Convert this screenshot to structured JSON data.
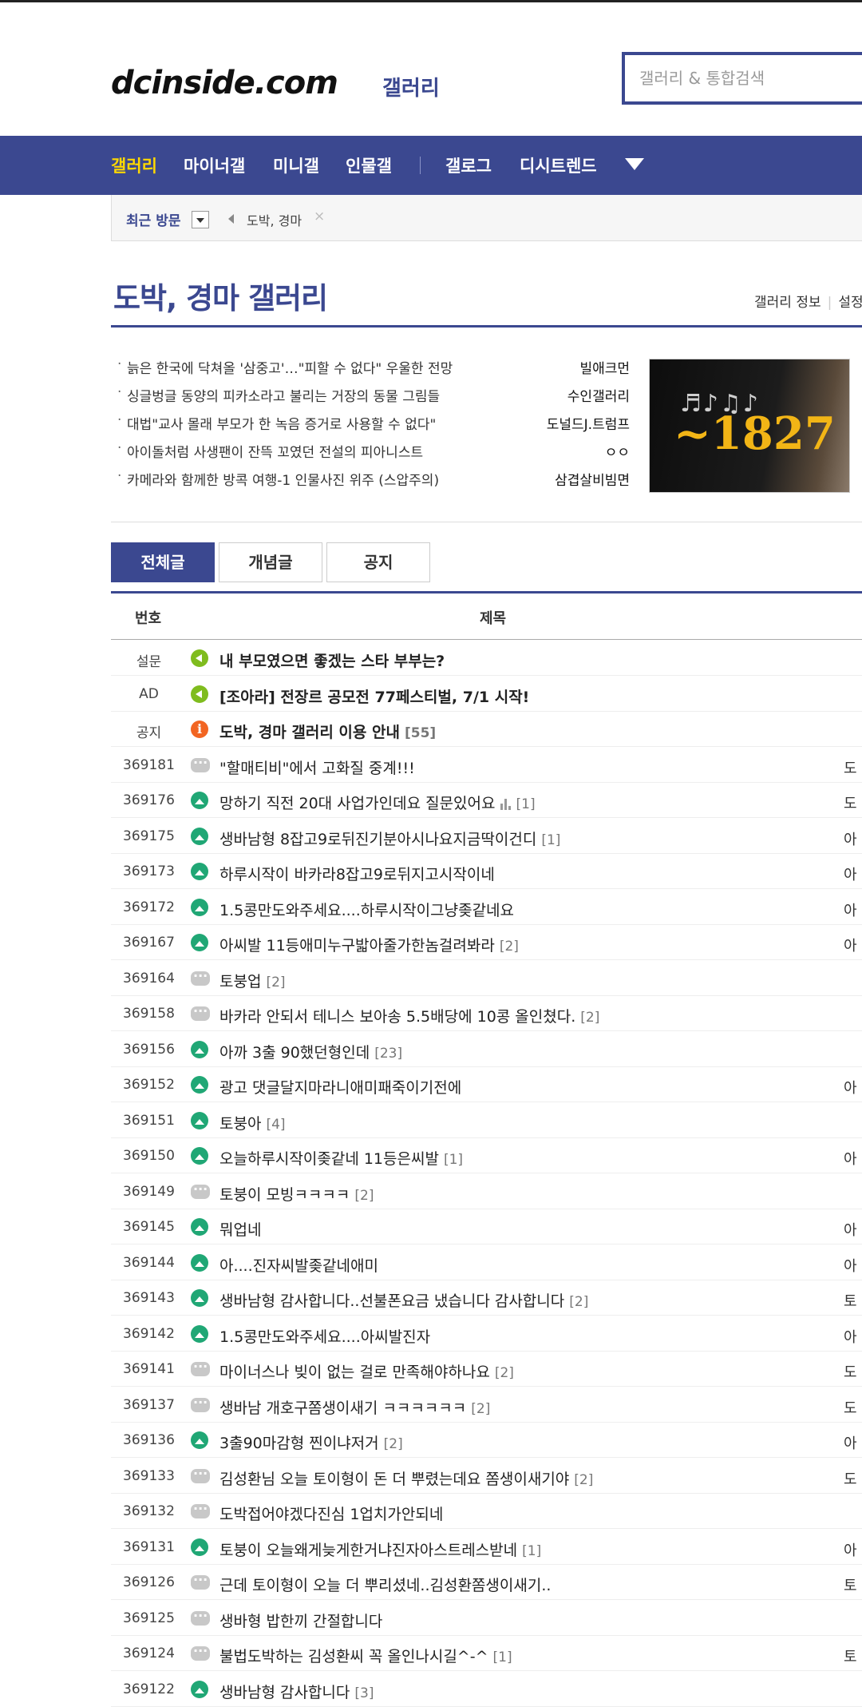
{
  "header": {
    "logo": "dcinside.com",
    "logo_sub": "갤러리",
    "search_placeholder": "갤러리 & 통합검색"
  },
  "nav": {
    "items": [
      {
        "label": "갤러리",
        "active": true
      },
      {
        "label": "마이너갤"
      },
      {
        "label": "미니갤"
      },
      {
        "label": "인물갤"
      },
      {
        "label": "갤로그"
      },
      {
        "label": "디시트렌드"
      }
    ]
  },
  "recent": {
    "label": "최근 방문",
    "item": "도박, 경마",
    "close": "×"
  },
  "gallery": {
    "title": "도박, 경마 갤러리",
    "info_link": "갤러리 정보",
    "info_sep": "|",
    "setting_link": "설정"
  },
  "news": [
    {
      "title": "늙은 한국에 닥쳐올 '삼중고'…\"피할 수 없다\" 우울한 전망",
      "source": "빌애크먼"
    },
    {
      "title": "싱글벙글 동양의 피카소라고 불리는 거장의 동물 그림들",
      "source": "수인갤러리"
    },
    {
      "title": "대법\"교사 몰래 부모가 한 녹음 증거로 사용할 수 없다\"",
      "source": "도널드J.트럼프"
    },
    {
      "title": "아이돌처럼 사생팬이 잔뜩 꼬였던 전설의 피아니스트",
      "source": "ㅇㅇ"
    },
    {
      "title": "카메라와 함께한 방콕 여행-1 인물사진 위주 (스압주의)",
      "source": "삼겹살비빔면"
    }
  ],
  "thumbnail": {
    "year": "~1827"
  },
  "tabs": [
    {
      "label": "전체글",
      "active": true
    },
    {
      "label": "개념글"
    },
    {
      "label": "공지"
    }
  ],
  "list_header": {
    "num": "번호",
    "subject": "제목"
  },
  "posts": [
    {
      "num": "설문",
      "icon": "sound",
      "subject": "내 부모였으면 좋겠는 스타 부부는?",
      "comments": "",
      "author": "",
      "notice": true
    },
    {
      "num": "AD",
      "icon": "sound",
      "subject": "[조아라] 전장르 공모전 77페스티벌, 7/1 시작!",
      "comments": "",
      "author": "",
      "notice": true
    },
    {
      "num": "공지",
      "icon": "info",
      "subject": "도박, 경마 갤러리 이용 안내",
      "comments": "[55]",
      "author": "",
      "notice": true
    },
    {
      "num": "369181",
      "icon": "text",
      "subject": "\"할매티비\"에서 고화질 중계!!!",
      "comments": "",
      "author": "도"
    },
    {
      "num": "369176",
      "icon": "image",
      "subject": "망하기 직전 20대 사업가인데요 질문있어요",
      "comments": "[1]",
      "author": "도",
      "chart": true
    },
    {
      "num": "369175",
      "icon": "image",
      "subject": "생바남형 8잡고9로뒤진기분아시나요지금딱이건디",
      "comments": "[1]",
      "author": "아"
    },
    {
      "num": "369173",
      "icon": "image",
      "subject": "하루시작이 바카라8잡고9로뒤지고시작이네",
      "comments": "",
      "author": "아"
    },
    {
      "num": "369172",
      "icon": "image",
      "subject": "1.5콩만도와주세요....하루시작이그냥좆같네요",
      "comments": "",
      "author": "아"
    },
    {
      "num": "369167",
      "icon": "image",
      "subject": "아씨발 11등애미누구밟아줄가한놈걸려봐라",
      "comments": "[2]",
      "author": "아"
    },
    {
      "num": "369164",
      "icon": "text",
      "subject": "토붕업",
      "comments": "[2]",
      "author": ""
    },
    {
      "num": "369158",
      "icon": "text",
      "subject": "바카라 안되서 테니스 보아송 5.5배당에 10콩 올인쳤다.",
      "comments": "[2]",
      "author": ""
    },
    {
      "num": "369156",
      "icon": "image",
      "subject": "아까 3출 90했던형인데",
      "comments": "[23]",
      "author": ""
    },
    {
      "num": "369152",
      "icon": "image",
      "subject": "광고 댓글달지마라니애미패죽이기전에",
      "comments": "",
      "author": "아"
    },
    {
      "num": "369151",
      "icon": "image",
      "subject": "토붕아",
      "comments": "[4]",
      "author": ""
    },
    {
      "num": "369150",
      "icon": "image",
      "subject": "오늘하루시작이좆같네 11등은씨발",
      "comments": "[1]",
      "author": "아"
    },
    {
      "num": "369149",
      "icon": "text",
      "subject": "토붕이 모빙ㅋㅋㅋㅋ",
      "comments": "[2]",
      "author": ""
    },
    {
      "num": "369145",
      "icon": "image",
      "subject": "뭐업네",
      "comments": "",
      "author": "아"
    },
    {
      "num": "369144",
      "icon": "image",
      "subject": "아....진자씨발좆같네애미",
      "comments": "",
      "author": "아"
    },
    {
      "num": "369143",
      "icon": "image",
      "subject": "생바남형 감사합니다..선불폰요금 냈습니다 감사합니다",
      "comments": "[2]",
      "author": "토"
    },
    {
      "num": "369142",
      "icon": "image",
      "subject": "1.5콩만도와주세요....아씨발진자",
      "comments": "",
      "author": "아"
    },
    {
      "num": "369141",
      "icon": "text",
      "subject": "마이너스나 빚이 없는 걸로 만족해야하나요",
      "comments": "[2]",
      "author": "도"
    },
    {
      "num": "369137",
      "icon": "text",
      "subject": "생바남 개호구쫌생이새기 ㅋㅋㅋㅋㅋㅋ",
      "comments": "[2]",
      "author": "도"
    },
    {
      "num": "369136",
      "icon": "image",
      "subject": "3출90마감형 찐이냐저거",
      "comments": "[2]",
      "author": "아"
    },
    {
      "num": "369133",
      "icon": "text",
      "subject": "김성환님 오늘 토이형이 돈 더 뿌렸는데요 쫌생이새기야",
      "comments": "[2]",
      "author": "도"
    },
    {
      "num": "369132",
      "icon": "text",
      "subject": "도박접어야겠다진심 1업치가안되네",
      "comments": "",
      "author": ""
    },
    {
      "num": "369131",
      "icon": "image",
      "subject": "토붕이 오늘왜게늦게한거냐진자아스트레스받네",
      "comments": "[1]",
      "author": "아"
    },
    {
      "num": "369126",
      "icon": "text",
      "subject": "근데 토이형이 오늘 더 뿌리셨네..김성환쫌생이새기..",
      "comments": "",
      "author": "토"
    },
    {
      "num": "369125",
      "icon": "text",
      "subject": "생바형 밥한끼 간절합니다",
      "comments": "",
      "author": ""
    },
    {
      "num": "369124",
      "icon": "text",
      "subject": "불법도박하는 김성환씨 꼭 올인나시길^-^",
      "comments": "[1]",
      "author": "토"
    },
    {
      "num": "369122",
      "icon": "image",
      "subject": "생바남형 감사합니다",
      "comments": "[3]",
      "author": ""
    }
  ]
}
